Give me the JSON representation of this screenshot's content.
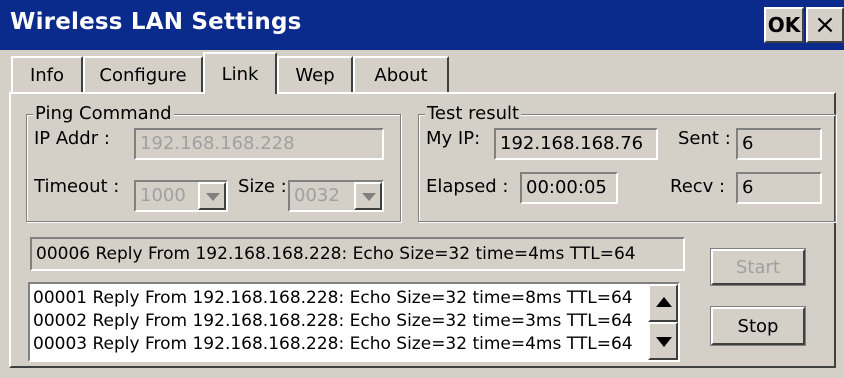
{
  "window": {
    "title": "Wireless LAN Settings",
    "ok_label": "OK",
    "close_label": "×"
  },
  "tabs": [
    {
      "label": "Info"
    },
    {
      "label": "Configure"
    },
    {
      "label": "Link",
      "active": true
    },
    {
      "label": "Wep"
    },
    {
      "label": "About"
    }
  ],
  "ping": {
    "group_label": "Ping Command",
    "ip_label": "IP Addr :",
    "ip_value": "192.168.168.228",
    "timeout_label": "Timeout :",
    "timeout_value": "1000",
    "size_label": "Size :",
    "size_value": "0032"
  },
  "result": {
    "group_label": "Test result",
    "myip_label": "My IP:",
    "myip_value": "192.168.168.76",
    "sent_label": "Sent :",
    "sent_value": "6",
    "elapsed_label": "Elapsed :",
    "elapsed_value": "00:00:05",
    "recv_label": "Recv :",
    "recv_value": "6"
  },
  "status_line": "00006 Reply From 192.168.168.228: Echo Size=32 time=4ms TTL=64",
  "log": [
    "00001 Reply From 192.168.168.228: Echo Size=32 time=8ms TTL=64",
    "00002 Reply From 192.168.168.228: Echo Size=32 time=3ms TTL=64",
    "00003 Reply From 192.168.168.228: Echo Size=32 time=4ms TTL=64"
  ],
  "buttons": {
    "start": "Start",
    "stop": "Stop"
  },
  "colors": {
    "titlebar": "#0a2a8c",
    "face": "#d4d0c8",
    "disabled_text": "#a0a0a0"
  }
}
